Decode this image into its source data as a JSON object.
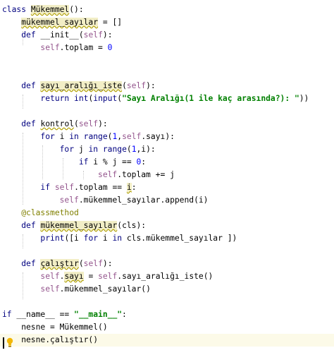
{
  "editor": {
    "lines": [
      "class Mükemmel():",
      "    mükemmel_sayılar = []",
      "    def __init__(self):",
      "        self.toplam = 0",
      "",
      "",
      "    def sayı_aralığı_iste(self):",
      "        return int(input(\"Sayı Aralığı(1 ile kaç arasında?): \"))",
      "",
      "    def kontrol(self):",
      "        for i in range(1,self.sayı):",
      "            for j in range(1,i):",
      "                if i % j == 0:",
      "                    self.toplam += j",
      "        if self.toplam == i:",
      "            self.mükemmel_sayılar.append(i)",
      "    @classmethod",
      "    def mükemmel_sayılar(cls):",
      "        print([i for i in cls.mükemmel_sayılar ])",
      "",
      "    def çalıştır(self):",
      "        self.sayı = self.sayı_aralığı_iste()",
      "        self.mükemmel_sayılar()",
      "",
      "if __name__ == \"__main__\":",
      "    nesne = Mükemmel()",
      "    nesne.çalıştır()"
    ],
    "icons": {
      "bulb": "lightbulb-icon"
    },
    "colors": {
      "keyword": "#000080",
      "string": "#008000",
      "number": "#0000ff",
      "self": "#94558d",
      "decorator": "#808000",
      "highlight": "#f2eec6"
    }
  }
}
